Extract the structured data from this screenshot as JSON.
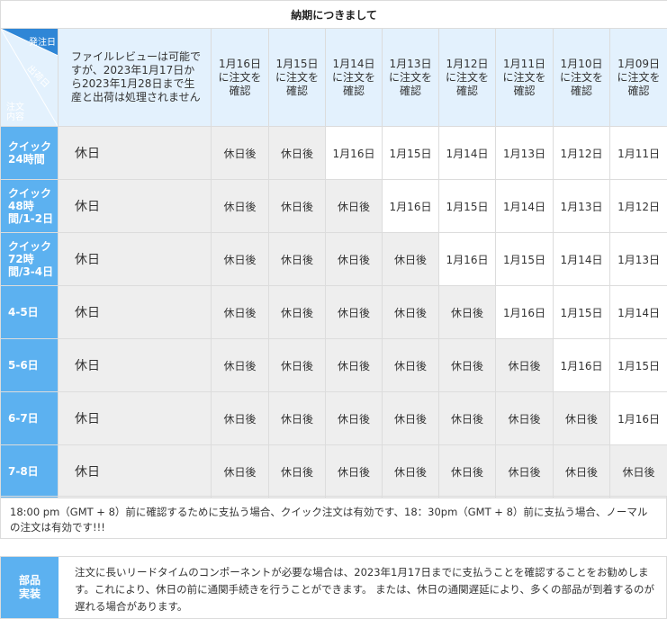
{
  "title": "納期につきまして",
  "corner": {
    "top": "発注日",
    "mid": "出荷日",
    "bottom1": "注文",
    "bottom2": "内容"
  },
  "header_desc": "ファイルレビューは可能ですが、2023年1月17日から2023年1月28日まで生産と出荷は処理されません",
  "columns": [
    "1月16日に注文を確認",
    "1月15日に注文を確認",
    "1月14日に注文を確認",
    "1月13日に注文を確認",
    "1月12日に注文を確認",
    "1月11日に注文を確認",
    "1月10日に注文を確認",
    "1月09日に注文を確認"
  ],
  "rows": [
    {
      "label": "クイック24時間",
      "holiday": "休日",
      "cells": [
        "休日後",
        "休日後",
        "1月16日",
        "1月15日",
        "1月14日",
        "1月13日",
        "1月12日",
        "1月11日"
      ]
    },
    {
      "label": "クイック48時間/1-2日",
      "holiday": "休日",
      "cells": [
        "休日後",
        "休日後",
        "休日後",
        "1月16日",
        "1月15日",
        "1月14日",
        "1月13日",
        "1月12日"
      ]
    },
    {
      "label": "クイック72時間/3-4日",
      "holiday": "休日",
      "cells": [
        "休日後",
        "休日後",
        "休日後",
        "休日後",
        "1月16日",
        "1月15日",
        "1月14日",
        "1月13日"
      ]
    },
    {
      "label": "4-5日",
      "holiday": "休日",
      "cells": [
        "休日後",
        "休日後",
        "休日後",
        "休日後",
        "休日後",
        "1月16日",
        "1月15日",
        "1月14日"
      ]
    },
    {
      "label": "5-6日",
      "holiday": "休日",
      "cells": [
        "休日後",
        "休日後",
        "休日後",
        "休日後",
        "休日後",
        "休日後",
        "1月16日",
        "1月15日"
      ]
    },
    {
      "label": "6-7日",
      "holiday": "休日",
      "cells": [
        "休日後",
        "休日後",
        "休日後",
        "休日後",
        "休日後",
        "休日後",
        "休日後",
        "1月16日"
      ]
    },
    {
      "label": "7-8日",
      "holiday": "休日",
      "cells": [
        "休日後",
        "休日後",
        "休日後",
        "休日後",
        "休日後",
        "休日後",
        "休日後",
        "休日後"
      ]
    }
  ],
  "note": "18:00 pm（GMT + 8）前に確認するために支払う場合、クイック注文は有効です、18：30pm（GMT + 8）前に支払う場合、ノーマルの注文は有効です!!!",
  "parts": {
    "label": "部品実装",
    "text": "注文に長いリードタイムのコンポーネントが必要な場合は、2023年1月17日までに支払うことを確認することをお勧めします。これにより、休日の前に通関手続きを行うことができます。 または、休日の通関遅延により、多くの部品が到着するのが遅れる場合があります。"
  },
  "colors": {
    "header_bg": "#e3f1fd",
    "label_bg": "#5cb1f0",
    "after_bg": "#eeeeee",
    "corner_blue": "#3b93e0"
  }
}
